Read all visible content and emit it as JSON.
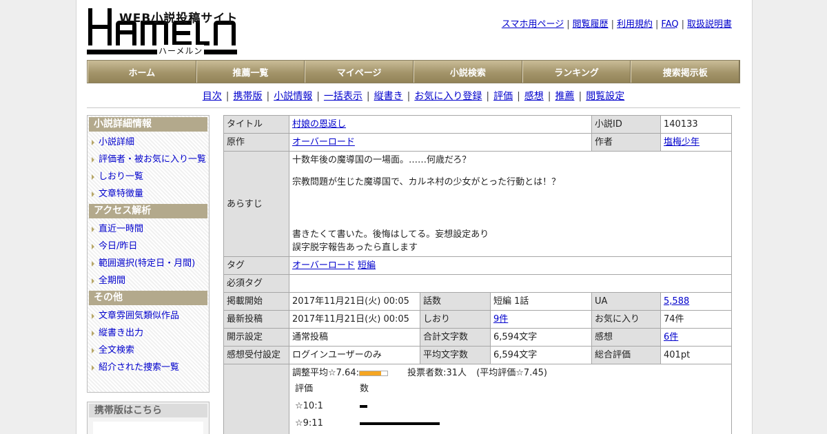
{
  "logo": {
    "tagline": "WEB小説投稿サイト",
    "wordmark": "HAMELN",
    "kana": "ハーメルン"
  },
  "top_links": [
    "スマホ用ページ",
    "閲覧履歴",
    "利用規約",
    "FAQ",
    "取扱説明書"
  ],
  "main_nav": [
    "ホーム",
    "推薦一覧",
    "マイページ",
    "小説検索",
    "ランキング",
    "捜索掲示板"
  ],
  "sub_nav": [
    "目次",
    "携帯版",
    "小説情報",
    "一括表示",
    "縦書き",
    "お気に入り登録",
    "評価",
    "感想",
    "推薦",
    "閲覧設定"
  ],
  "sidebar": {
    "sections": [
      {
        "title": "小説詳細情報",
        "items": [
          "小説詳細",
          "評価者・被お気に入り一覧",
          "しおり一覧",
          "文章特徴量"
        ]
      },
      {
        "title": "アクセス解析",
        "items": [
          "直近一時間",
          "今日/昨日",
          "範囲選択(特定日・月間)",
          "全期間"
        ]
      },
      {
        "title": "その他",
        "items": [
          "文章雰囲気類似作品",
          "縦書き出力",
          "全文検索",
          "紹介された捜索一覧"
        ]
      }
    ],
    "mobile_title": "携帯版はこちら"
  },
  "details": {
    "title_label": "タイトル",
    "title": "村娘の恩返し",
    "novel_id_label": "小説ID",
    "novel_id": "140133",
    "original_label": "原作",
    "original": "オーバーロード",
    "author_label": "作者",
    "author": "塩梅少年",
    "synopsis_label": "あらすじ",
    "synopsis_lines": [
      "十数年後の魔導国の一場面。……何歳だろ？",
      "宗教問題が生じた魔導国で、カルネ村の少女がとった行動とは！？",
      "書きたくて書いた。後悔はしてる。妄想設定あり",
      "誤字脱字報告あったら直します"
    ],
    "tags_label": "タグ",
    "tags": [
      "オーバーロード",
      "短編"
    ],
    "required_tags_label": "必須タグ",
    "rows": [
      [
        [
          "掲載開始",
          "2017年11月21日(火) 00:05"
        ],
        [
          "話数",
          "短編 1話"
        ],
        [
          "UA",
          "5,588"
        ]
      ],
      [
        [
          "最新投稿",
          "2017年11月21日(火) 00:05"
        ],
        [
          "しおり",
          "9件"
        ],
        [
          "お気に入り",
          "74件"
        ]
      ],
      [
        [
          "開示設定",
          "通常投稿"
        ],
        [
          "合計文字数",
          "6,594文字"
        ],
        [
          "感想",
          "6件"
        ]
      ],
      [
        [
          "感想受付設定",
          "ログインユーザーのみ"
        ],
        [
          "平均文字数",
          "6,594文字"
        ],
        [
          "総合評価",
          "401pt"
        ]
      ]
    ],
    "rating": {
      "adjusted_avg_label": "調整平均☆7.64:",
      "adjusted_avg": 7.64,
      "votes": "投票者数:31人",
      "plain_avg": "(平均評価☆7.45)",
      "col_rating": "評価",
      "col_count": "数",
      "dist_labels": [
        "☆10:1",
        "☆9:11"
      ],
      "dist_counts": [
        1,
        11
      ]
    }
  },
  "colors": {
    "nav": "#a3946a",
    "side_head": "#b3a98c",
    "link": "#0000cc"
  }
}
